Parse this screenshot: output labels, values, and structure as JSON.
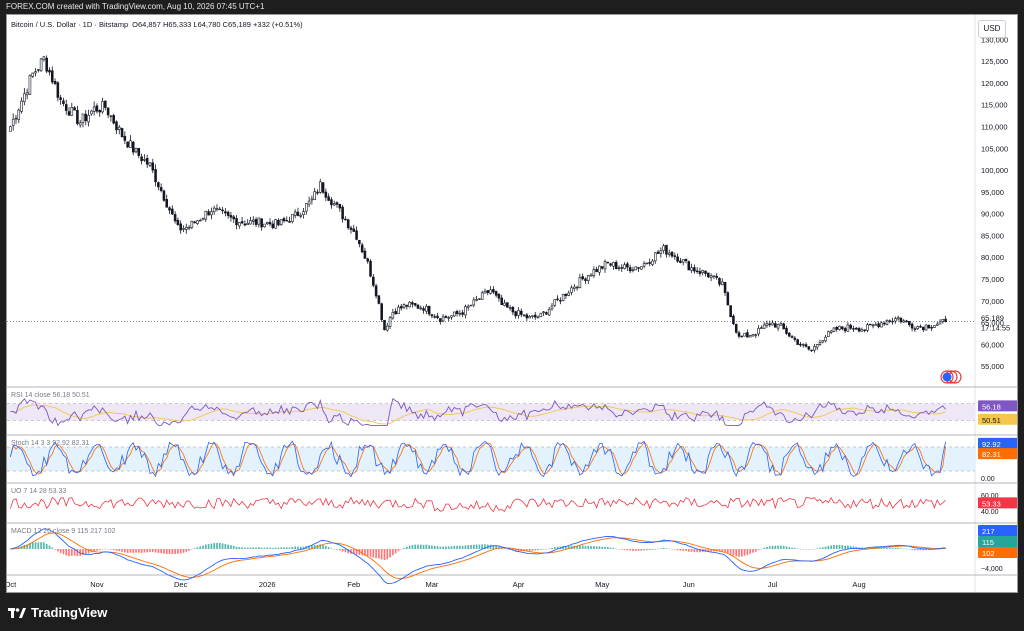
{
  "header": {
    "caption": "FOREX.COM created with TradingView.com, Aug 10, 2026 07:45 UTC+1"
  },
  "footer": {
    "brand": "TradingView"
  },
  "currency_button": "USD",
  "colors": {
    "up": "#131722",
    "down": "#131722",
    "rsi_line": "#7e57c2",
    "rsi_ma": "#f5c64b",
    "stoch_k": "#2962ff",
    "stoch_d": "#ff6d00",
    "uo": "#f23645",
    "macd_line": "#2962ff",
    "signal_line": "#ff6d00",
    "hist_pos": "#26a69a",
    "hist_neg": "#ff5252",
    "rsi_band": "#ede7f6",
    "stoch_band": "#e3f2fd"
  },
  "chart_data": [
    {
      "type": "candlestick",
      "title": "Bitcoin / U.S. Dollar · 1D · Bitstamp",
      "ohlc_header": {
        "O": "64,857",
        "H": "65,333",
        "L": "64,780",
        "C": "65,189",
        "change": "+332 (+0.51%)"
      },
      "last_price": "65,189",
      "countdown": "17:14:55",
      "y_ticks": [
        "130,000",
        "125,000",
        "120,000",
        "115,000",
        "110,000",
        "105,000",
        "100,000",
        "95,000",
        "90,000",
        "85,000",
        "80,000",
        "75,000",
        "70,000",
        "65,000",
        "60,000",
        "55,000"
      ],
      "ylim": [
        52500,
        131000
      ],
      "x_labels": [
        "Oct",
        "Nov",
        "Dec",
        "2026",
        "Feb",
        "Mar",
        "Apr",
        "May",
        "Jun",
        "Jul",
        "Aug"
      ],
      "price_keypoints": [
        [
          0,
          110000
        ],
        [
          8,
          122000
        ],
        [
          12,
          125500
        ],
        [
          15,
          121000
        ],
        [
          18,
          116000
        ],
        [
          25,
          111000
        ],
        [
          30,
          114000
        ],
        [
          34,
          114500
        ],
        [
          40,
          108000
        ],
        [
          45,
          104000
        ],
        [
          50,
          101000
        ],
        [
          55,
          94000
        ],
        [
          60,
          86500
        ],
        [
          64,
          87000
        ],
        [
          67,
          88500
        ],
        [
          72,
          91000
        ],
        [
          78,
          89000
        ],
        [
          84,
          88000
        ],
        [
          90,
          88000
        ],
        [
          96,
          87500
        ],
        [
          102,
          89500
        ],
        [
          108,
          93000
        ],
        [
          111,
          96500
        ],
        [
          114,
          94000
        ],
        [
          118,
          90500
        ],
        [
          124,
          85000
        ],
        [
          128,
          78500
        ],
        [
          131,
          72000
        ],
        [
          134,
          63500
        ],
        [
          137,
          67500
        ],
        [
          142,
          69000
        ],
        [
          148,
          68500
        ],
        [
          154,
          66000
        ],
        [
          158,
          66500
        ],
        [
          162,
          67500
        ],
        [
          168,
          70500
        ],
        [
          172,
          72500
        ],
        [
          176,
          69000
        ],
        [
          180,
          67500
        ],
        [
          186,
          66000
        ],
        [
          190,
          66500
        ],
        [
          196,
          70000
        ],
        [
          202,
          73500
        ],
        [
          208,
          76500
        ],
        [
          214,
          78500
        ],
        [
          220,
          77500
        ],
        [
          226,
          78000
        ],
        [
          231,
          80500
        ],
        [
          234,
          81800
        ],
        [
          238,
          80500
        ],
        [
          244,
          77500
        ],
        [
          250,
          76000
        ],
        [
          255,
          73500
        ],
        [
          258,
          67000
        ],
        [
          261,
          61500
        ],
        [
          264,
          62000
        ],
        [
          268,
          63000
        ],
        [
          272,
          65000
        ],
        [
          276,
          64000
        ],
        [
          280,
          61500
        ],
        [
          284,
          59500
        ],
        [
          287,
          58500
        ],
        [
          290,
          61000
        ],
        [
          296,
          63500
        ],
        [
          302,
          64000
        ],
        [
          306,
          63500
        ],
        [
          310,
          64500
        ],
        [
          314,
          65500
        ],
        [
          318,
          66000
        ],
        [
          322,
          64500
        ],
        [
          326,
          64000
        ],
        [
          330,
          64500
        ],
        [
          334,
          65000
        ],
        [
          335,
          65189
        ]
      ],
      "series": [
        {
          "name": "RSI",
          "params": "14 close",
          "value": "56.18"
        },
        {
          "name": "RSI-based MA",
          "value": "50.51"
        },
        {
          "name": "Stoch %K",
          "params": "14 3 3",
          "value": "92.92"
        },
        {
          "name": "Stoch %D",
          "value": "82.31"
        },
        {
          "name": "UO",
          "params": "7 14 28",
          "value": "53.33"
        },
        {
          "name": "MACD",
          "params": "12 26 close 9",
          "values": [
            "115",
            "217",
            "102"
          ]
        }
      ],
      "indicators": {
        "rsi": {
          "label": "RSI 14 close",
          "value": "56.18",
          "ma_value": "50.51"
        },
        "stoch": {
          "label": "Stoch 14 3 3",
          "k": "92.92",
          "d": "82.31",
          "low_tick": "0.00"
        },
        "uo": {
          "label": "UO 7 14 28",
          "value": "53.33",
          "ticks": [
            "60.00",
            "40.00"
          ]
        },
        "macd": {
          "label": "MACD 12 26 close 9",
          "hist": "115",
          "macd": "217",
          "signal": "102",
          "tick": "−4,000"
        }
      }
    }
  ]
}
